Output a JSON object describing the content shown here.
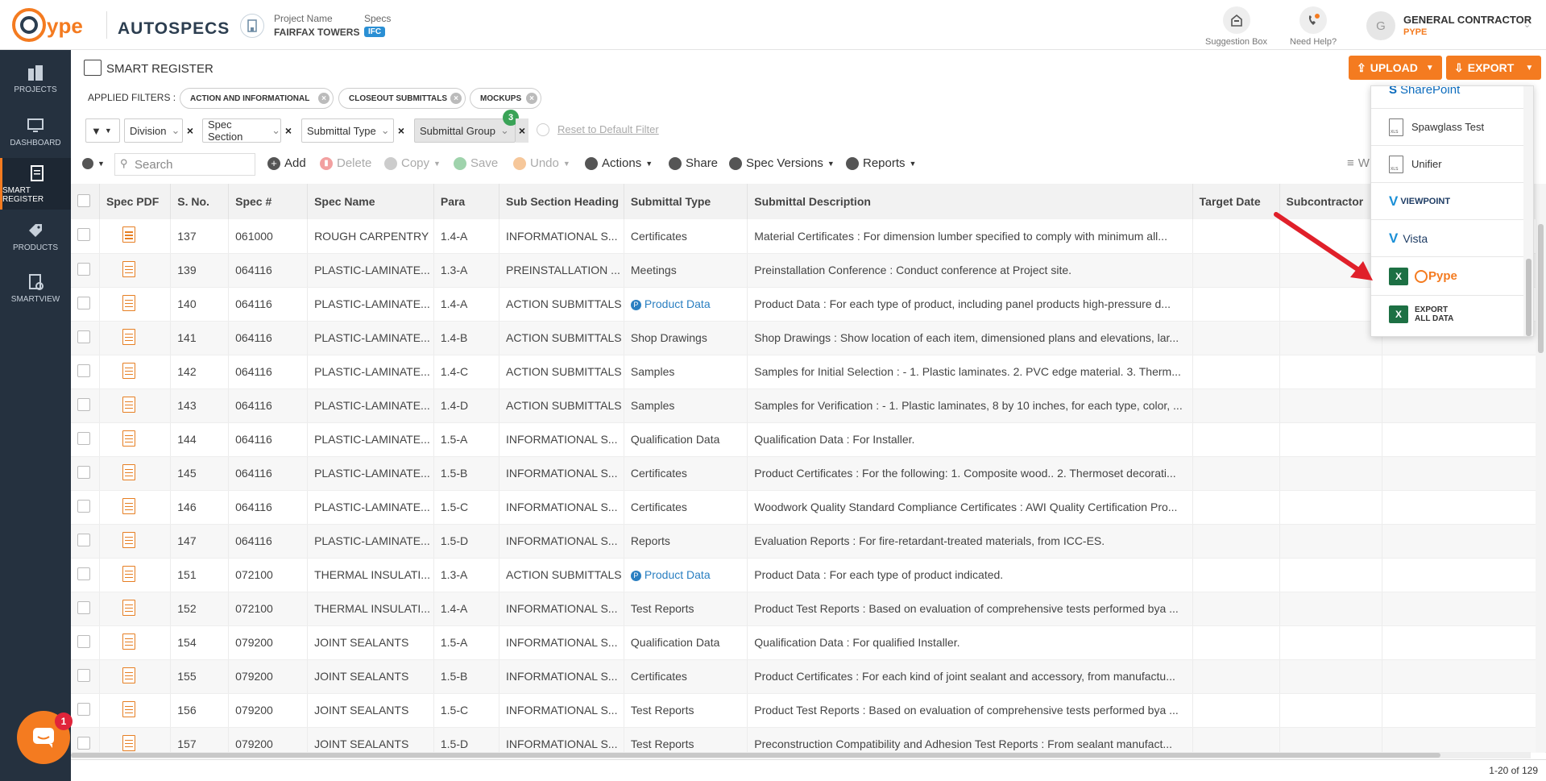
{
  "app": {
    "logo_text": "Pype",
    "product": "AUTOSPECS",
    "project_label": "Project Name",
    "project_name": "FAIRFAX TOWERS",
    "specs_label": "Specs",
    "specs_badge": "IFC"
  },
  "top_actions": {
    "suggestion": "Suggestion Box",
    "help": "Need Help?"
  },
  "user": {
    "initial": "G",
    "role": "GENERAL CONTRACTOR",
    "org": "PYPE"
  },
  "sidebar": {
    "items": [
      {
        "label": "PROJECTS"
      },
      {
        "label": "DASHBOARD"
      },
      {
        "label": "SMART REGISTER"
      },
      {
        "label": "PRODUCTS"
      },
      {
        "label": "SMARTVIEW"
      }
    ]
  },
  "page": {
    "title": "SMART REGISTER",
    "upload": "UPLOAD",
    "export": "EXPORT"
  },
  "filters": {
    "label": "APPLIED FILTERS :",
    "chips": [
      "ACTION AND INFORMATIONAL",
      "CLOSEOUT SUBMITTALS",
      "MOCKUPS"
    ],
    "division": "Division",
    "spec_section": "Spec Section",
    "submittal_type": "Submittal Type",
    "submittal_group": "Submittal Group",
    "group_count": "3",
    "reset": "Reset to Default Filter"
  },
  "toolbar": {
    "search_placeholder": "Search",
    "add": "Add",
    "delete": "Delete",
    "copy": "Copy",
    "save": "Save",
    "undo": "Undo",
    "actions": "Actions",
    "share": "Share",
    "spec_versions": "Spec Versions",
    "reports": "Reports",
    "partial": "W"
  },
  "table": {
    "headers": [
      "Spec PDF",
      "S. No.",
      "Spec #",
      "Spec Name",
      "Para",
      "Sub Section Heading",
      "Submittal Type",
      "Submittal Description",
      "Target Date",
      "Subcontractor"
    ],
    "rows": [
      {
        "sno": "137",
        "spec": "061000",
        "name": "ROUGH CARPENTRY",
        "para": "1.4-A",
        "sub": "INFORMATIONAL S...",
        "type": "Certificates",
        "link": false,
        "desc": "Material Certificates : For dimension lumber specified to comply with minimum all..."
      },
      {
        "sno": "139",
        "spec": "064116",
        "name": "PLASTIC-LAMINATE...",
        "para": "1.3-A",
        "sub": "PREINSTALLATION ...",
        "type": "Meetings",
        "link": false,
        "desc": "Preinstallation Conference : Conduct conference at Project site."
      },
      {
        "sno": "140",
        "spec": "064116",
        "name": "PLASTIC-LAMINATE...",
        "para": "1.4-A",
        "sub": "ACTION SUBMITTALS",
        "type": "Product Data",
        "link": true,
        "desc": "Product Data : For each type of product, including panel products high-pressure d..."
      },
      {
        "sno": "141",
        "spec": "064116",
        "name": "PLASTIC-LAMINATE...",
        "para": "1.4-B",
        "sub": "ACTION SUBMITTALS",
        "type": "Shop Drawings",
        "link": false,
        "desc": "Shop Drawings : Show location of each item, dimensioned plans and elevations, lar..."
      },
      {
        "sno": "142",
        "spec": "064116",
        "name": "PLASTIC-LAMINATE...",
        "para": "1.4-C",
        "sub": "ACTION SUBMITTALS",
        "type": "Samples",
        "link": false,
        "desc": "Samples for Initial Selection : - 1. Plastic laminates. 2. PVC edge material. 3. Therm..."
      },
      {
        "sno": "143",
        "spec": "064116",
        "name": "PLASTIC-LAMINATE...",
        "para": "1.4-D",
        "sub": "ACTION SUBMITTALS",
        "type": "Samples",
        "link": false,
        "desc": "Samples for Verification : - 1. Plastic laminates, 8 by 10 inches, for each type, color, ..."
      },
      {
        "sno": "144",
        "spec": "064116",
        "name": "PLASTIC-LAMINATE...",
        "para": "1.5-A",
        "sub": "INFORMATIONAL S...",
        "type": "Qualification Data",
        "link": false,
        "desc": "Qualification Data : For Installer."
      },
      {
        "sno": "145",
        "spec": "064116",
        "name": "PLASTIC-LAMINATE...",
        "para": "1.5-B",
        "sub": "INFORMATIONAL S...",
        "type": "Certificates",
        "link": false,
        "desc": "Product Certificates : For the following: 1. Composite wood.. 2. Thermoset decorati..."
      },
      {
        "sno": "146",
        "spec": "064116",
        "name": "PLASTIC-LAMINATE...",
        "para": "1.5-C",
        "sub": "INFORMATIONAL S...",
        "type": "Certificates",
        "link": false,
        "desc": "Woodwork Quality Standard Compliance Certificates : AWI Quality Certification Pro..."
      },
      {
        "sno": "147",
        "spec": "064116",
        "name": "PLASTIC-LAMINATE...",
        "para": "1.5-D",
        "sub": "INFORMATIONAL S...",
        "type": "Reports",
        "link": false,
        "desc": "Evaluation Reports : For fire-retardant-treated materials, from ICC-ES."
      },
      {
        "sno": "151",
        "spec": "072100",
        "name": "THERMAL INSULATI...",
        "para": "1.3-A",
        "sub": "ACTION SUBMITTALS",
        "type": "Product Data",
        "link": true,
        "desc": "Product Data : For each type of product indicated."
      },
      {
        "sno": "152",
        "spec": "072100",
        "name": "THERMAL INSULATI...",
        "para": "1.4-A",
        "sub": "INFORMATIONAL S...",
        "type": "Test Reports",
        "link": false,
        "desc": "Product Test Reports : Based on evaluation of comprehensive tests performed bya ..."
      },
      {
        "sno": "154",
        "spec": "079200",
        "name": "JOINT SEALANTS",
        "para": "1.5-A",
        "sub": "INFORMATIONAL S...",
        "type": "Qualification Data",
        "link": false,
        "desc": "Qualification Data : For qualified Installer."
      },
      {
        "sno": "155",
        "spec": "079200",
        "name": "JOINT SEALANTS",
        "para": "1.5-B",
        "sub": "INFORMATIONAL S...",
        "type": "Certificates",
        "link": false,
        "desc": "Product Certificates : For each kind of joint sealant and accessory, from manufactu..."
      },
      {
        "sno": "156",
        "spec": "079200",
        "name": "JOINT SEALANTS",
        "para": "1.5-C",
        "sub": "INFORMATIONAL S...",
        "type": "Test Reports",
        "link": false,
        "desc": "Product Test Reports : Based on evaluation of comprehensive tests performed bya ..."
      },
      {
        "sno": "157",
        "spec": "079200",
        "name": "JOINT SEALANTS",
        "para": "1.5-D",
        "sub": "INFORMATIONAL S...",
        "type": "Test Reports",
        "link": false,
        "desc": "Preconstruction Compatibility and Adhesion Test Reports : From sealant manufact..."
      }
    ]
  },
  "export_menu": {
    "items": [
      {
        "label": "SharePoint"
      },
      {
        "label": "Spawglass Test"
      },
      {
        "label": "Unifier"
      },
      {
        "label": "VIEWPOINT"
      },
      {
        "label": "Vista"
      },
      {
        "label": "Pype"
      },
      {
        "label": "EXPORT ALL DATA"
      }
    ]
  },
  "footer": {
    "pager": "1-20 of 129"
  },
  "chat": {
    "badge": "1"
  },
  "colors": {
    "accent": "#f47b20",
    "sidebar": "#25313f",
    "link": "#2a7fc1",
    "excel": "#1d7044"
  }
}
